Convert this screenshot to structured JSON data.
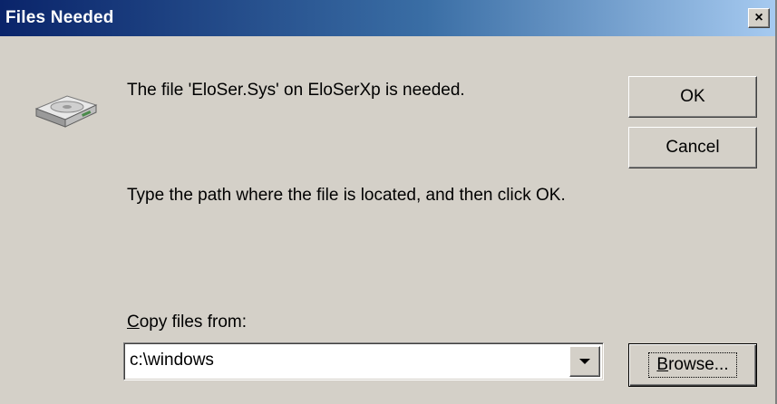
{
  "window": {
    "title": "Files Needed",
    "close_glyph": "×"
  },
  "message": {
    "line1": "The file 'EloSer.Sys' on EloSerXp is needed.",
    "line2": "Type the path where the file is located, and then click OK."
  },
  "buttons": {
    "ok": "OK",
    "cancel": "Cancel",
    "browse_accel": "B",
    "browse_rest": "rowse..."
  },
  "copy_from": {
    "label_accel": "C",
    "label_rest": "opy files from:",
    "value": "c:\\windows"
  },
  "icons": {
    "dialog_icon": "disk-drive-icon",
    "combo_arrow": "chevron-down-icon",
    "close": "close-icon"
  }
}
